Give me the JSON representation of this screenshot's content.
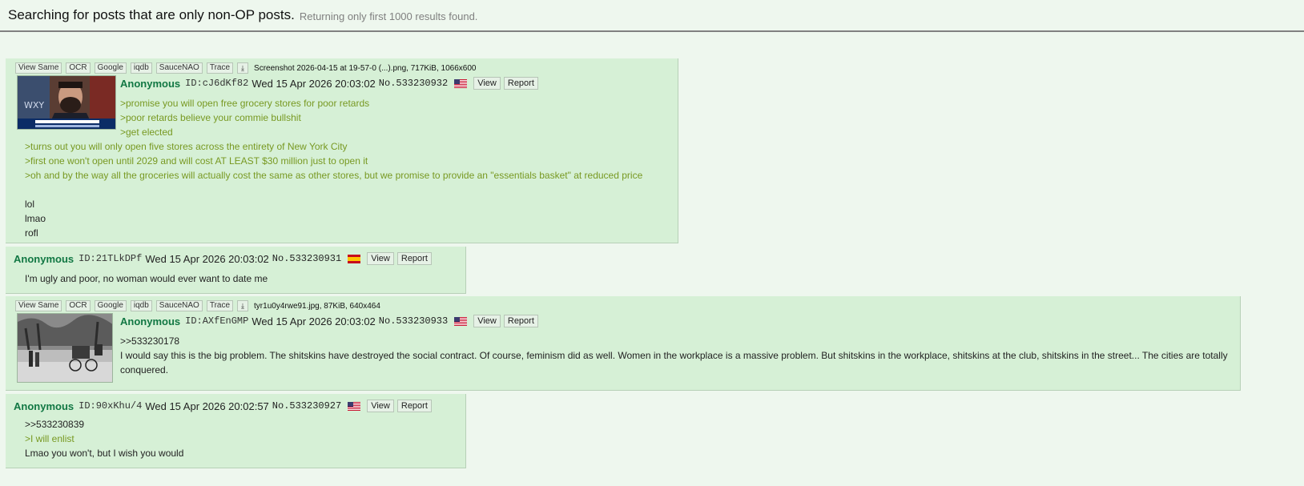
{
  "search": {
    "title": "Searching for posts that are only non-OP posts.",
    "subtitle": "Returning only first 1000 results found."
  },
  "tools": [
    "View Same",
    "OCR",
    "Google",
    "iqdb",
    "SauceNAO",
    "Trace"
  ],
  "post_actions": {
    "view": "View",
    "report": "Report"
  },
  "posts": [
    {
      "file_info": "Screenshot 2026-04-15 at 19-57-0 (...).png, 717KiB, 1066x600",
      "name": "Anonymous",
      "id": "ID:cJ6dKf82",
      "date": "Wed 15 Apr 2026 20:03:02",
      "no": "No.533230932",
      "flag": "us-flag",
      "lines": [
        ">promise you will open free grocery stores for poor retards",
        ">poor retards believe your commie bullshit",
        ">get elected",
        ">turns out you will only open five stores across the entirety of New York City",
        ">first one won't open until 2029 and will cost AT LEAST $30 million just to open it",
        ">oh and by the way all the groceries will actually cost the same as other stores, but we promise to provide an \"essentials basket\" at reduced price",
        "lol",
        "lmao",
        "rofl"
      ]
    },
    {
      "name": "Anonymous",
      "id": "ID:21TLkDPf",
      "date": "Wed 15 Apr 2026 20:03:02",
      "no": "No.533230931",
      "flag": "spain-flag",
      "lines": [
        "I'm ugly and poor, no woman would ever want to date me"
      ]
    },
    {
      "file_info": "tyr1u0y4rwe91.jpg, 87KiB, 640x464",
      "name": "Anonymous",
      "id": "ID:AXfEnGMP",
      "date": "Wed 15 Apr 2026 20:03:02",
      "no": "No.533230933",
      "flag": "us-flag",
      "lines": [
        ">>533230178",
        "I would say this is the big problem. The shitskins have destroyed the social contract. Of course, feminism did as well. Women in the workplace is a massive problem. But shitskins in the workplace, shitskins at the club, shitskins in the street... The cities are totally conquered."
      ]
    },
    {
      "name": "Anonymous",
      "id": "ID:90xKhu/4",
      "date": "Wed 15 Apr 2026 20:02:57",
      "no": "No.533230927",
      "flag": "us-flag",
      "lines": [
        ">>533230839",
        ">I will enlist",
        "Lmao you won't, but I wish you would"
      ]
    }
  ],
  "colors": {
    "background": "#eef7ee",
    "post_background": "#d6f0d6",
    "name": "#117743",
    "greentext": "#789922"
  }
}
